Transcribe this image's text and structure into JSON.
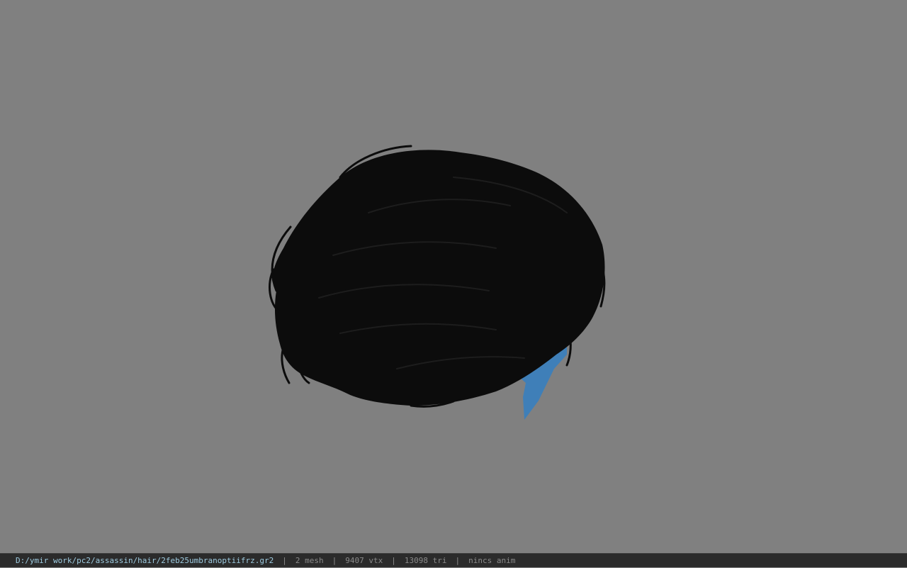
{
  "viewport": {
    "background_color": "#808080",
    "model": {
      "hair_color": "#0c0c0c",
      "collar_color": "#3f7fb8"
    }
  },
  "status_bar": {
    "file_path": "D:/ymir work/pc2/assassin/hair/2feb25umbranoptiifrz.gr2",
    "separator": "|",
    "mesh_count": "2 mesh",
    "vertex_count": "9407 vtx",
    "triangle_count": "13098 tri",
    "anim_status": "nincs anim"
  }
}
